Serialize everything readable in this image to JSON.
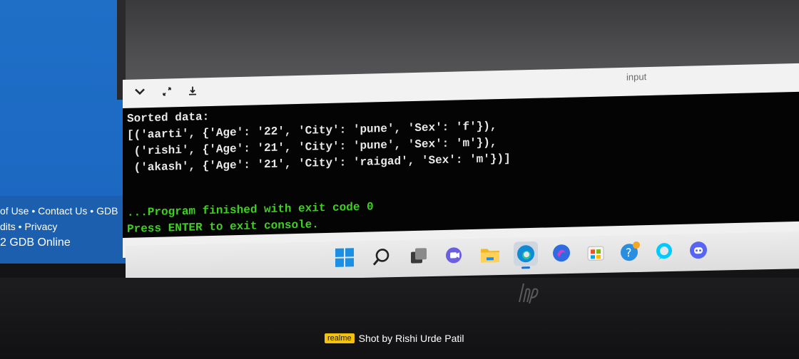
{
  "website_footer": {
    "line1": "of Use • Contact Us • GDB",
    "line2": "dits • Privacy",
    "line3": "2 GDB Online"
  },
  "console": {
    "toolbar_label": "input",
    "lines": [
      "Sorted data:",
      "[('aarti', {'Age': '22', 'City': 'pune', 'Sex': 'f'}),",
      " ('rishi', {'Age': '21', 'City': 'pune', 'Sex': 'm'}),",
      " ('akash', {'Age': '21', 'City': 'raigad', 'Sex': 'm'})]"
    ],
    "status_line1": "...Program finished with exit code 0",
    "status_line2": "Press ENTER to exit console."
  },
  "taskbar": {
    "apps": [
      "start-icon",
      "search-icon",
      "task-view-icon",
      "chat-icon",
      "file-explorer-icon",
      "edge-icon",
      "edge-beta-icon",
      "store-icon",
      "help-icon",
      "alexa-icon",
      "discord-icon"
    ],
    "active_app": "edge-icon"
  },
  "watermark": {
    "brand": "realme",
    "credit": "Shot by Rishi Urde Patil"
  },
  "colors": {
    "console_bg": "#040404",
    "console_text": "#e9e9e9",
    "status_green": "#3fd11f",
    "site_blue": "#1f6fc7"
  }
}
